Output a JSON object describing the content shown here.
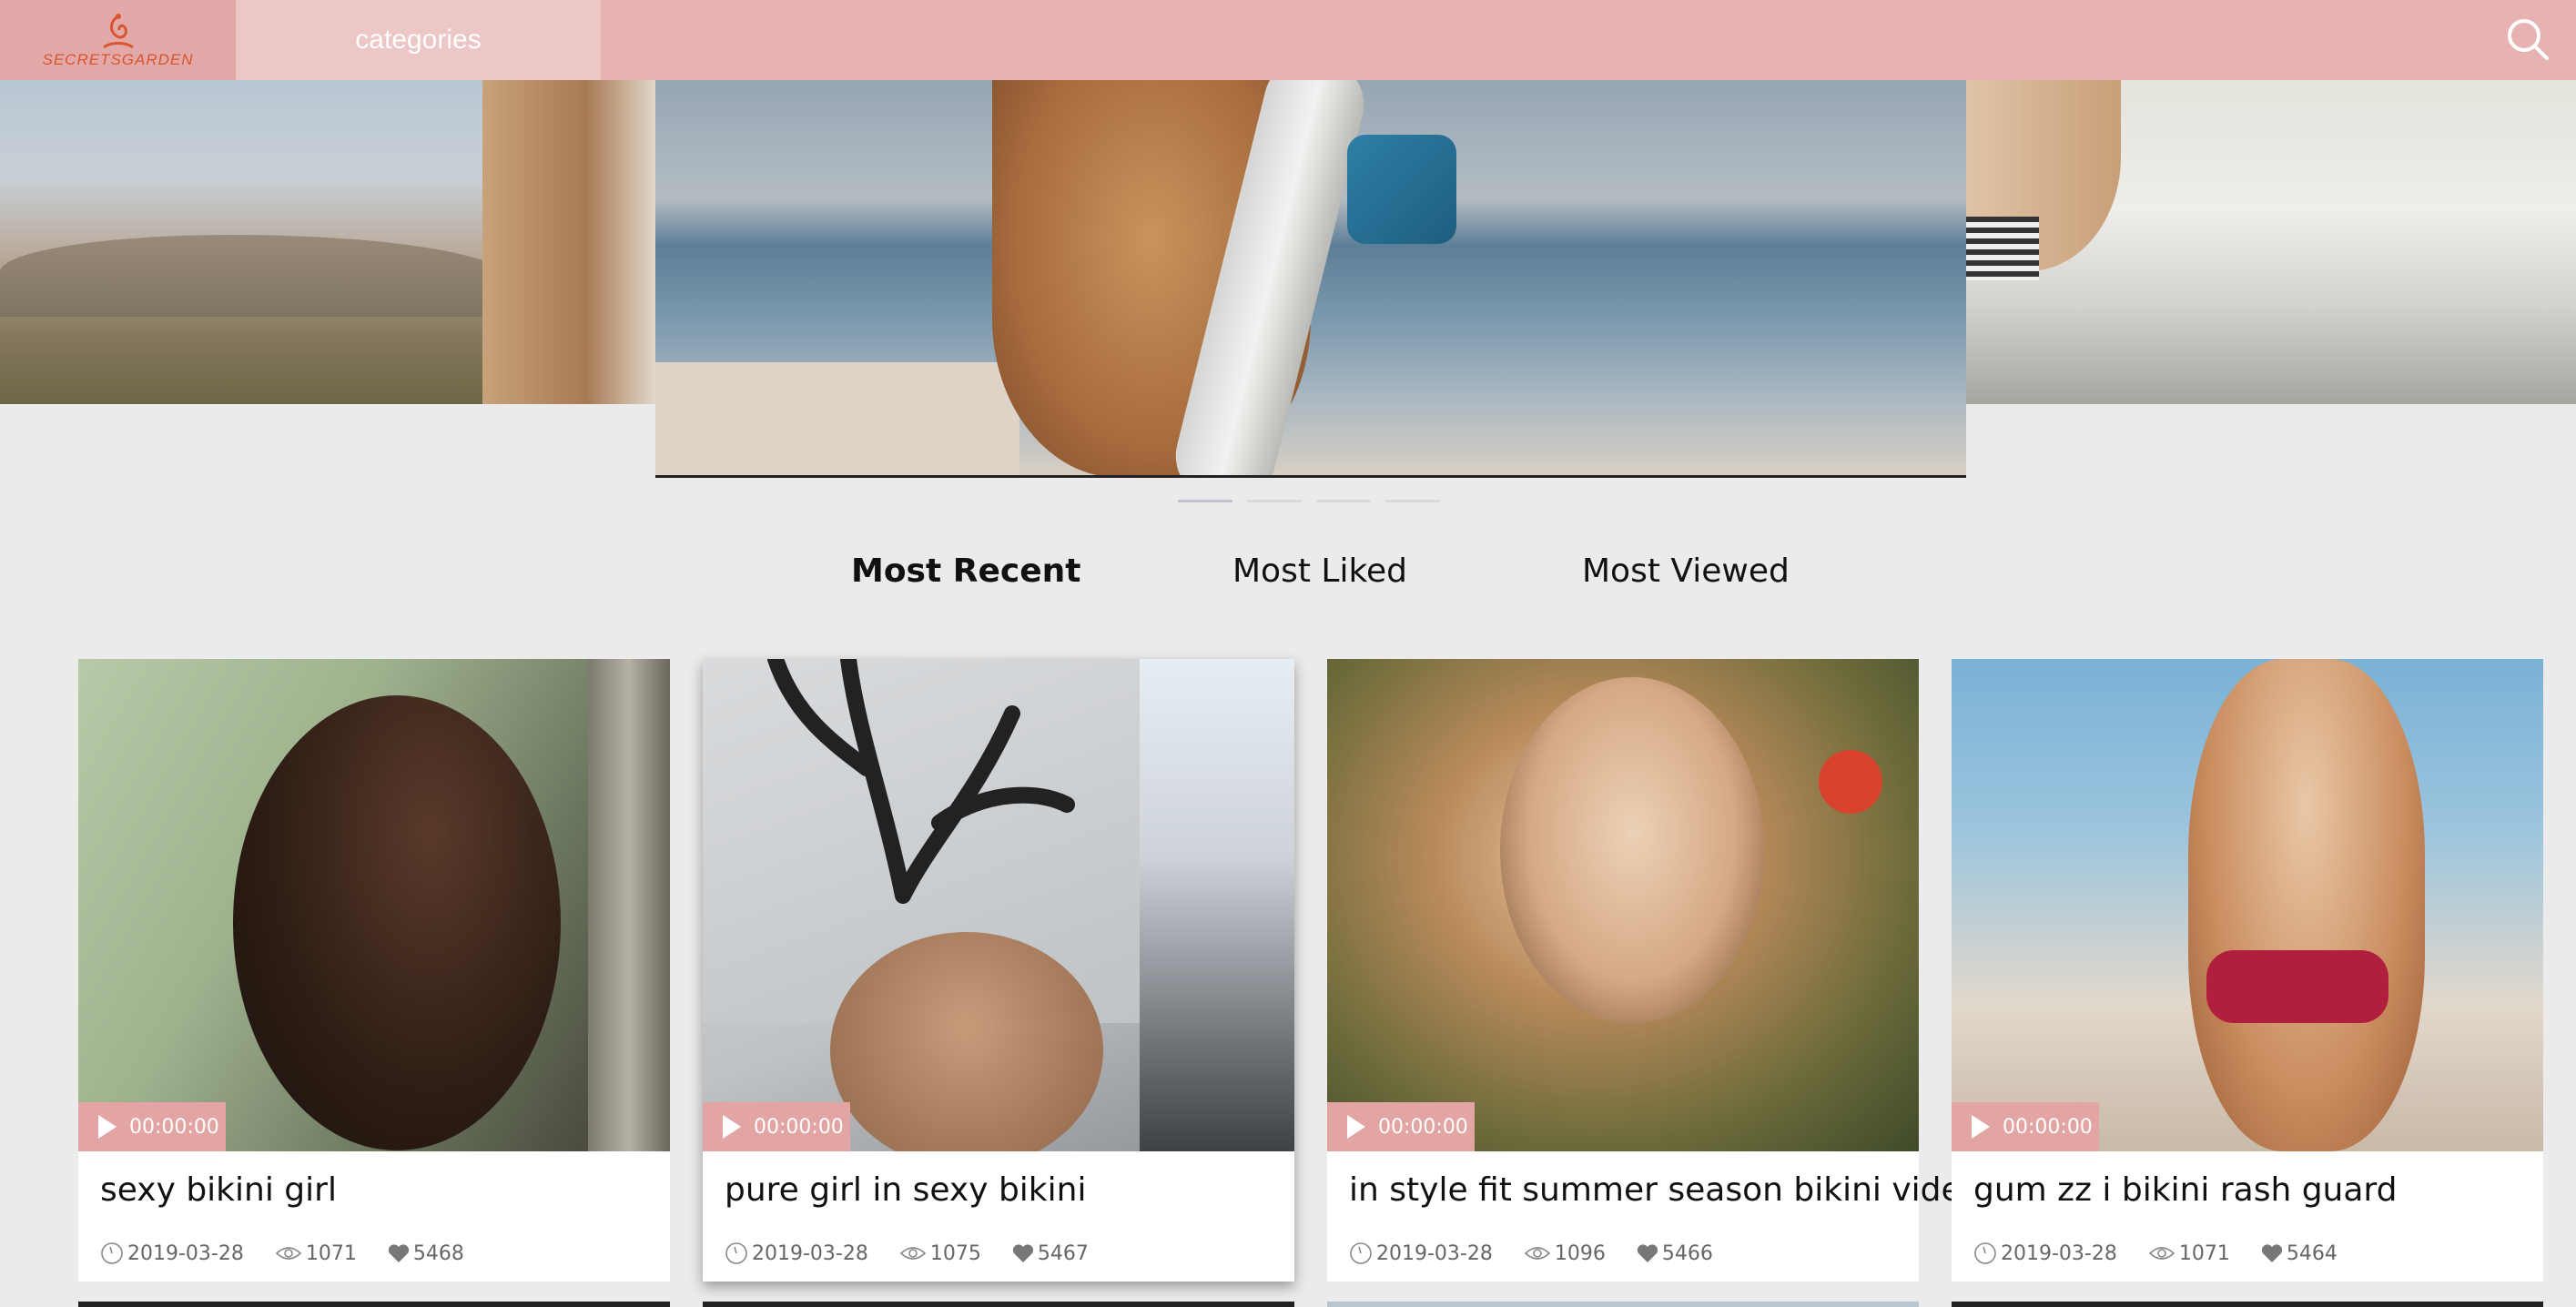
{
  "header": {
    "logo_text": "SECRETSGARDEN",
    "nav_categories": "categories",
    "search_icon": "search-icon"
  },
  "carousel": {
    "slide_count": 4,
    "active_index": 0
  },
  "tabs": [
    {
      "label": "Most Recent",
      "active": true
    },
    {
      "label": "Most Liked",
      "active": false
    },
    {
      "label": "Most Viewed",
      "active": false
    }
  ],
  "videos": [
    {
      "duration": "00:00:00",
      "title": "sexy bikini girl",
      "date": "2019-03-28",
      "views": "1071",
      "likes": "5468"
    },
    {
      "duration": "00:00:00",
      "title": "pure girl in sexy bikini",
      "date": "2019-03-28",
      "views": "1075",
      "likes": "5467"
    },
    {
      "duration": "00:00:00",
      "title": "in style fit summer season bikini video",
      "date": "2019-03-28",
      "views": "1096",
      "likes": "5466"
    },
    {
      "duration": "00:00:00",
      "title": "gum zz i bikini rash guard",
      "date": "2019-03-28",
      "views": "1071",
      "likes": "5464"
    }
  ],
  "colors": {
    "header_bg": "#e6b2b2",
    "logo_bg": "#e3a8a8",
    "categories_bg": "#edc6c6",
    "duration_badge": "#e3a4a4",
    "page_bg": "#ebebeb"
  }
}
